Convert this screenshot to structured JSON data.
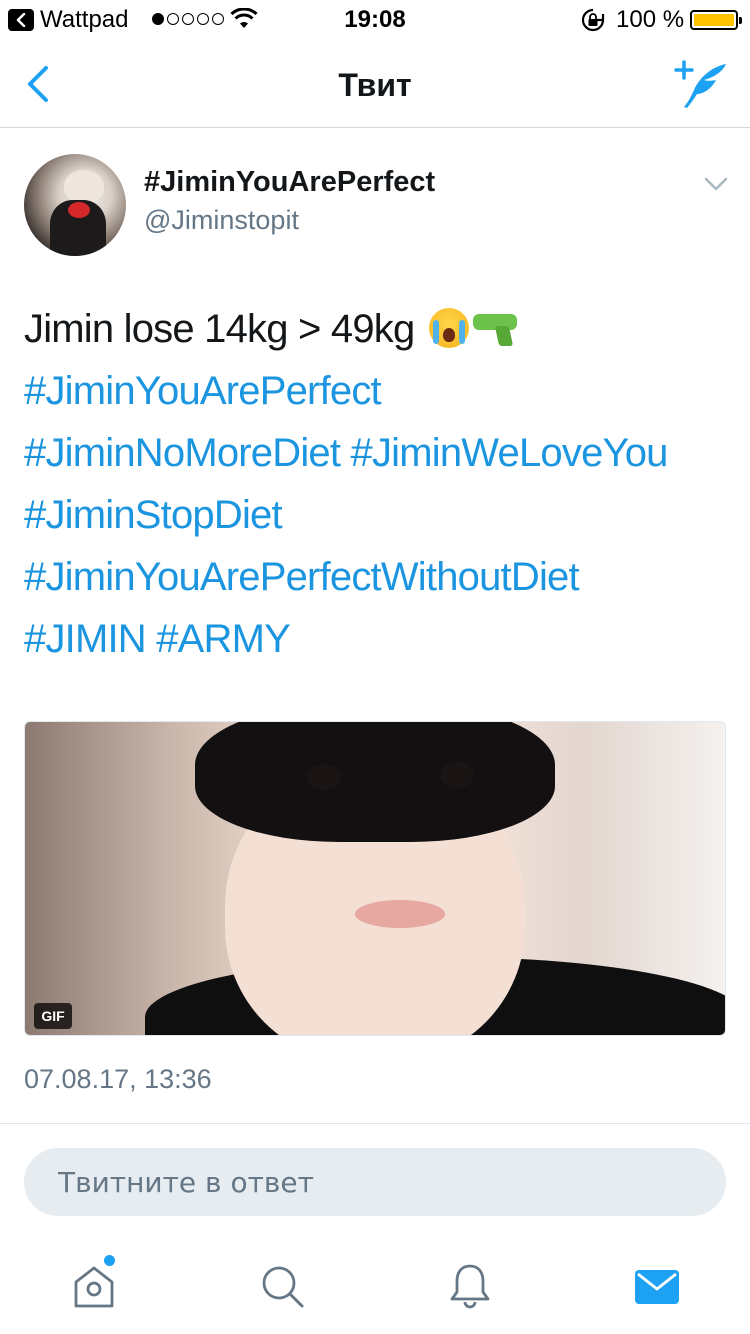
{
  "status_bar": {
    "back_app": "Wattpad",
    "time": "19:08",
    "battery": "100 %",
    "battery_level": 1.0,
    "signal_bars_on": 1,
    "signal_bars_total": 5
  },
  "nav": {
    "title": "Твит"
  },
  "tweet": {
    "display_name": "#JiminYouArePerfect",
    "handle": "@Jiminstopit",
    "text_plain": "Jimin lose 14kg > 49kg ",
    "emojis": [
      "loudly-crying-face",
      "water-pistol"
    ],
    "hashtags": [
      "#JiminYouArePerfect",
      "#JiminNoMoreDiet",
      "#JiminWeLoveYou",
      "#JiminStopDiet",
      "#JiminYouArePerfectWithoutDiet",
      "#JIMIN",
      "#ARMY"
    ],
    "media_badge": "GIF",
    "timestamp": "07.08.17, 13:36"
  },
  "reply": {
    "placeholder": "Твитните в ответ"
  },
  "tabs": [
    {
      "name": "home",
      "icon": "home-icon",
      "has_notification_dot": true
    },
    {
      "name": "search",
      "icon": "search-icon"
    },
    {
      "name": "notifications",
      "icon": "bell-icon"
    },
    {
      "name": "messages",
      "icon": "envelope-icon",
      "active": true
    }
  ],
  "colors": {
    "accent": "#1da1f2",
    "hashtag": "#1b95e0",
    "secondary_text": "#657786",
    "battery_fill": "#ffc400"
  }
}
